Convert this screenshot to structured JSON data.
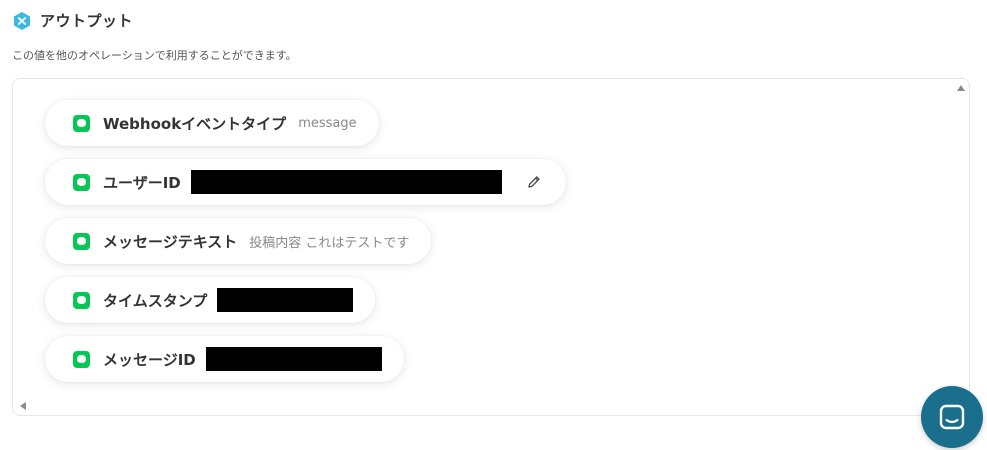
{
  "header": {
    "title": "アウトプット",
    "description": "この値を他のオペレーションで利用することができます。"
  },
  "outputs": [
    {
      "label": "Webhookイベントタイプ",
      "value": "message"
    },
    {
      "label": "ユーザーID",
      "value": ""
    },
    {
      "label": "メッセージテキスト",
      "value": "投稿内容 これはテストです"
    },
    {
      "label": "タイムスタンプ",
      "value": ""
    },
    {
      "label": "メッセージID",
      "value": ""
    }
  ],
  "icons": {
    "brand": "yoom-logo-icon",
    "item": "line-app-icon",
    "edit": "pencil-icon",
    "chat": "chat-icon"
  },
  "colors": {
    "brand": "#3fb8e0",
    "line_green": "#06c755",
    "chat_button": "#1a6f8c"
  }
}
